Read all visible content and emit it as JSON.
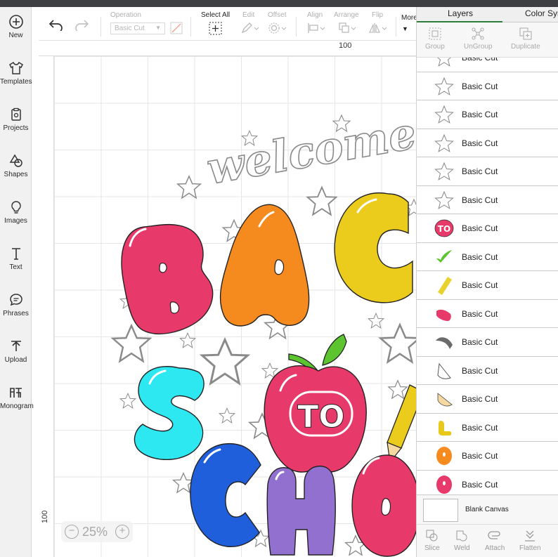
{
  "leftnav": {
    "items": [
      {
        "label": "New",
        "icon": "plus-circle-icon"
      },
      {
        "label": "Templates",
        "icon": "shirt-icon"
      },
      {
        "label": "Projects",
        "icon": "clipboard-icon"
      },
      {
        "label": "Shapes",
        "icon": "shapes-icon"
      },
      {
        "label": "Images",
        "icon": "lightbulb-icon"
      },
      {
        "label": "Text",
        "icon": "text-icon"
      },
      {
        "label": "Phrases",
        "icon": "speech-bubble-icon"
      },
      {
        "label": "Upload",
        "icon": "upload-icon"
      },
      {
        "label": "Monogram",
        "icon": "monogram-icon"
      }
    ]
  },
  "toolbar": {
    "operation_label": "Operation",
    "operation_value": "Basic Cut",
    "select_all_label": "Select All",
    "edit_label": "Edit",
    "offset_label": "Offset",
    "align_label": "Align",
    "arrange_label": "Arrange",
    "flip_label": "Flip",
    "more_label": "More"
  },
  "canvas": {
    "ruler_top_label": "100",
    "ruler_left_label": "100",
    "zoom_value": "25%",
    "zoom_minus": "−",
    "zoom_plus": "+",
    "design_text": {
      "welcome": "welcome",
      "to": "TO",
      "letters": [
        "B",
        "A",
        "C",
        "S",
        "C",
        "H",
        "O"
      ]
    }
  },
  "panel": {
    "tabs": [
      "Layers",
      "Color Sync"
    ],
    "group_buttons": [
      {
        "label": "Group",
        "icon": "group-icon"
      },
      {
        "label": "UnGroup",
        "icon": "ungroup-icon"
      },
      {
        "label": "Duplicate",
        "icon": "duplicate-icon"
      }
    ],
    "layers": [
      {
        "name": "Basic Cut",
        "thumb": "star-outline",
        "color": "#ffffff"
      },
      {
        "name": "Basic Cut",
        "thumb": "star-outline",
        "color": "#ffffff"
      },
      {
        "name": "Basic Cut",
        "thumb": "star-outline",
        "color": "#ffffff"
      },
      {
        "name": "Basic Cut",
        "thumb": "star-outline",
        "color": "#ffffff"
      },
      {
        "name": "Basic Cut",
        "thumb": "star-outline",
        "color": "#ffffff"
      },
      {
        "name": "Basic Cut",
        "thumb": "star-outline",
        "color": "#ffffff"
      },
      {
        "name": "Basic Cut",
        "thumb": "to-badge",
        "color": "#e83a6a"
      },
      {
        "name": "Basic Cut",
        "thumb": "leaf",
        "color": "#5cc42f"
      },
      {
        "name": "Basic Cut",
        "thumb": "pencil-body",
        "color": "#e8d22d"
      },
      {
        "name": "Basic Cut",
        "thumb": "eraser",
        "color": "#e83a6a"
      },
      {
        "name": "Basic Cut",
        "thumb": "pencil-tip-dark",
        "color": "#6b6b6b"
      },
      {
        "name": "Basic Cut",
        "thumb": "pencil-tip-outline",
        "color": "#ffffff"
      },
      {
        "name": "Basic Cut",
        "thumb": "pencil-wood",
        "color": "#f6d9a0"
      },
      {
        "name": "Basic Cut",
        "thumb": "letter-l",
        "color": "#e8c81a"
      },
      {
        "name": "Basic Cut",
        "thumb": "dot",
        "color": "#f58a1f"
      },
      {
        "name": "Basic Cut",
        "thumb": "dot",
        "color": "#e83a6a"
      }
    ],
    "blank_canvas_label": "Blank Canvas",
    "bottom_buttons": [
      {
        "label": "Slice",
        "icon": "slice-icon"
      },
      {
        "label": "Weld",
        "icon": "weld-icon"
      },
      {
        "label": "Attach",
        "icon": "attach-icon"
      },
      {
        "label": "Flatten",
        "icon": "flatten-icon"
      }
    ]
  },
  "colors": {
    "pink": "#e83a6a",
    "orange": "#f58a1f",
    "yellow": "#ebcb1c",
    "cyan": "#2de8f0",
    "blue": "#1f5fdc",
    "purple": "#9170cf",
    "green": "#5cc42f",
    "accent": "#2f7d3b"
  }
}
